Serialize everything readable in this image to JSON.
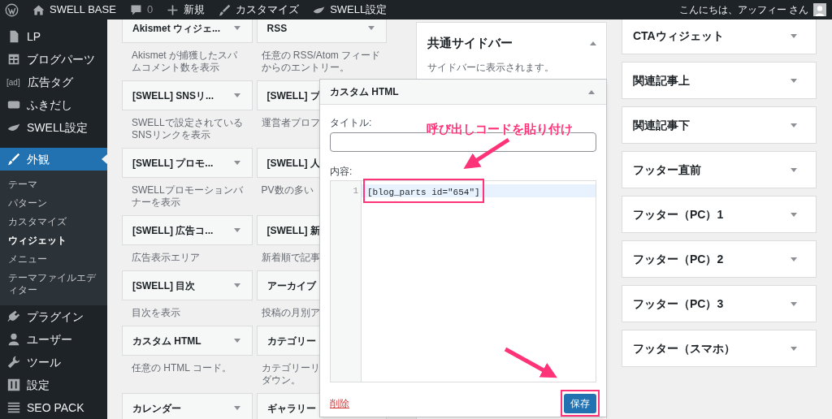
{
  "admin_bar": {
    "items": [
      {
        "kind": "wp-logo"
      },
      {
        "kind": "home",
        "label": "SWELL BASE"
      },
      {
        "kind": "comments",
        "label": "0"
      },
      {
        "kind": "new",
        "label": "新規"
      },
      {
        "kind": "customize",
        "label": "カスタマイズ"
      },
      {
        "kind": "swell",
        "label": "SWELL設定"
      }
    ],
    "greeting": "こんにちは、アッフィー さん"
  },
  "sidebar": {
    "groups": [
      {
        "items": [
          {
            "label": "LP",
            "selected": false
          },
          {
            "label": "ブログパーツ",
            "selected": false
          },
          {
            "icon_text": "[ad]",
            "label": "広告タグ",
            "selected": false
          },
          {
            "label": "ふきだし",
            "selected": false
          },
          {
            "label": "SWELL設定",
            "selected": false
          }
        ]
      },
      {
        "items": [
          {
            "label": "外観",
            "selected": true,
            "children": [
              {
                "label": "テーマ",
                "selected": false
              },
              {
                "label": "パターン",
                "selected": false
              },
              {
                "label": "カスタマイズ",
                "selected": false
              },
              {
                "label": "ウィジェット",
                "selected": true
              },
              {
                "label": "メニュー",
                "selected": false
              },
              {
                "label": "テーマファイルエディター",
                "selected": false
              }
            ]
          },
          {
            "label": "プラグイン",
            "selected": false
          },
          {
            "label": "ユーザー",
            "selected": false
          },
          {
            "label": "ツール",
            "selected": false
          },
          {
            "label": "設定",
            "selected": false
          },
          {
            "label": "SEO PACK",
            "selected": false
          }
        ]
      }
    ]
  },
  "available_widgets": [
    {
      "title": "Akismet ウィジェ...",
      "description": "Akismet が捕獲したスパムコメント数を表示"
    },
    {
      "title": "RSS",
      "description": "任意の RSS/Atom フィードからのエントリー。"
    },
    {
      "title": "[SWELL] SNSリ...",
      "description": "SWELLで設定されているSNSリンクを表示"
    },
    {
      "title": "[SWELL] プ",
      "description": "運営者プロフ"
    },
    {
      "title": "[SWELL] プロモ...",
      "description": "SWELLプロモーションバナーを表示"
    },
    {
      "title": "[SWELL] 人",
      "description": "PV数の多い"
    },
    {
      "title": "[SWELL] 広告コ...",
      "description": "広告表示エリア"
    },
    {
      "title": "[SWELL] 新",
      "description": "新着順で記事"
    },
    {
      "title": "[SWELL] 目次",
      "description": "目次を表示"
    },
    {
      "title": "アーカイブ",
      "description": "投稿の月別ア"
    },
    {
      "title": "カスタム HTML",
      "description": "任意の HTML コード。"
    },
    {
      "title": "カテゴリー",
      "description_lines": [
        "カテゴリーリ",
        "ダウン。"
      ]
    },
    {
      "title": "カレンダー"
    },
    {
      "title": "ギャラリー"
    }
  ],
  "main_sidebar": {
    "title": "共通サイドバー",
    "description": "サイドバーに表示されます。",
    "expanded": true
  },
  "other_sidebars": [
    {
      "title": "CTAウィジェット",
      "expanded": false
    },
    {
      "title": "関連記事上",
      "expanded": false
    },
    {
      "title": "関連記事下",
      "expanded": false
    },
    {
      "title": "フッター直前",
      "expanded": false
    },
    {
      "title": "フッター（PC）1",
      "expanded": false
    },
    {
      "title": "フッター（PC）2",
      "expanded": false
    },
    {
      "title": "フッター（PC）3",
      "expanded": false
    },
    {
      "title": "フッター（スマホ）",
      "expanded": false
    }
  ],
  "widget_editor": {
    "title": "カスタム HTML",
    "expanded": true,
    "title_label": "タイトル:",
    "content_label": "内容:",
    "code_lines": [
      {
        "number": "1",
        "text": "[blog_parts id=\"654\"]",
        "highlighted": true
      }
    ],
    "delete_label": "削除",
    "save_label": "保存"
  },
  "annotation": {
    "text": "呼び出しコードを貼り付け"
  }
}
